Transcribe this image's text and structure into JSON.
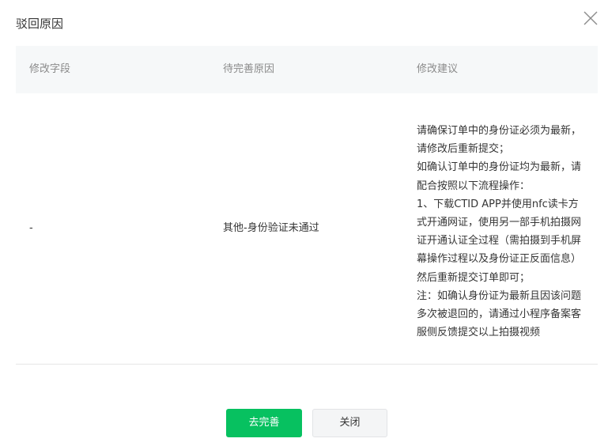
{
  "dialog": {
    "title": "驳回原因",
    "close_icon": "close-icon"
  },
  "table": {
    "columns": [
      "修改字段",
      "待完善原因",
      "修改建议"
    ],
    "rows": [
      {
        "field": "-",
        "reason": "其他-身份验证未通过",
        "advice": "请确保订单中的身份证必须为最新，请修改后重新提交；\n如确认订单中的身份证均为最新，请配合按照以下流程操作：\n1、下载CTID APP并使用nfc读卡方式开通网证，使用另一部手机拍摄网证开通认证全过程（需拍摄到手机屏幕操作过程以及身份证正反面信息）然后重新提交订单即可；\n注：如确认身份证为最新且因该问题多次被退回的，请通过小程序备案客服侧反馈提交以上拍摄视频"
      }
    ]
  },
  "footer": {
    "primary_label": "去完善",
    "close_label": "关闭"
  },
  "colors": {
    "accent": "#07c160",
    "header_bg": "#f6f8f9"
  }
}
